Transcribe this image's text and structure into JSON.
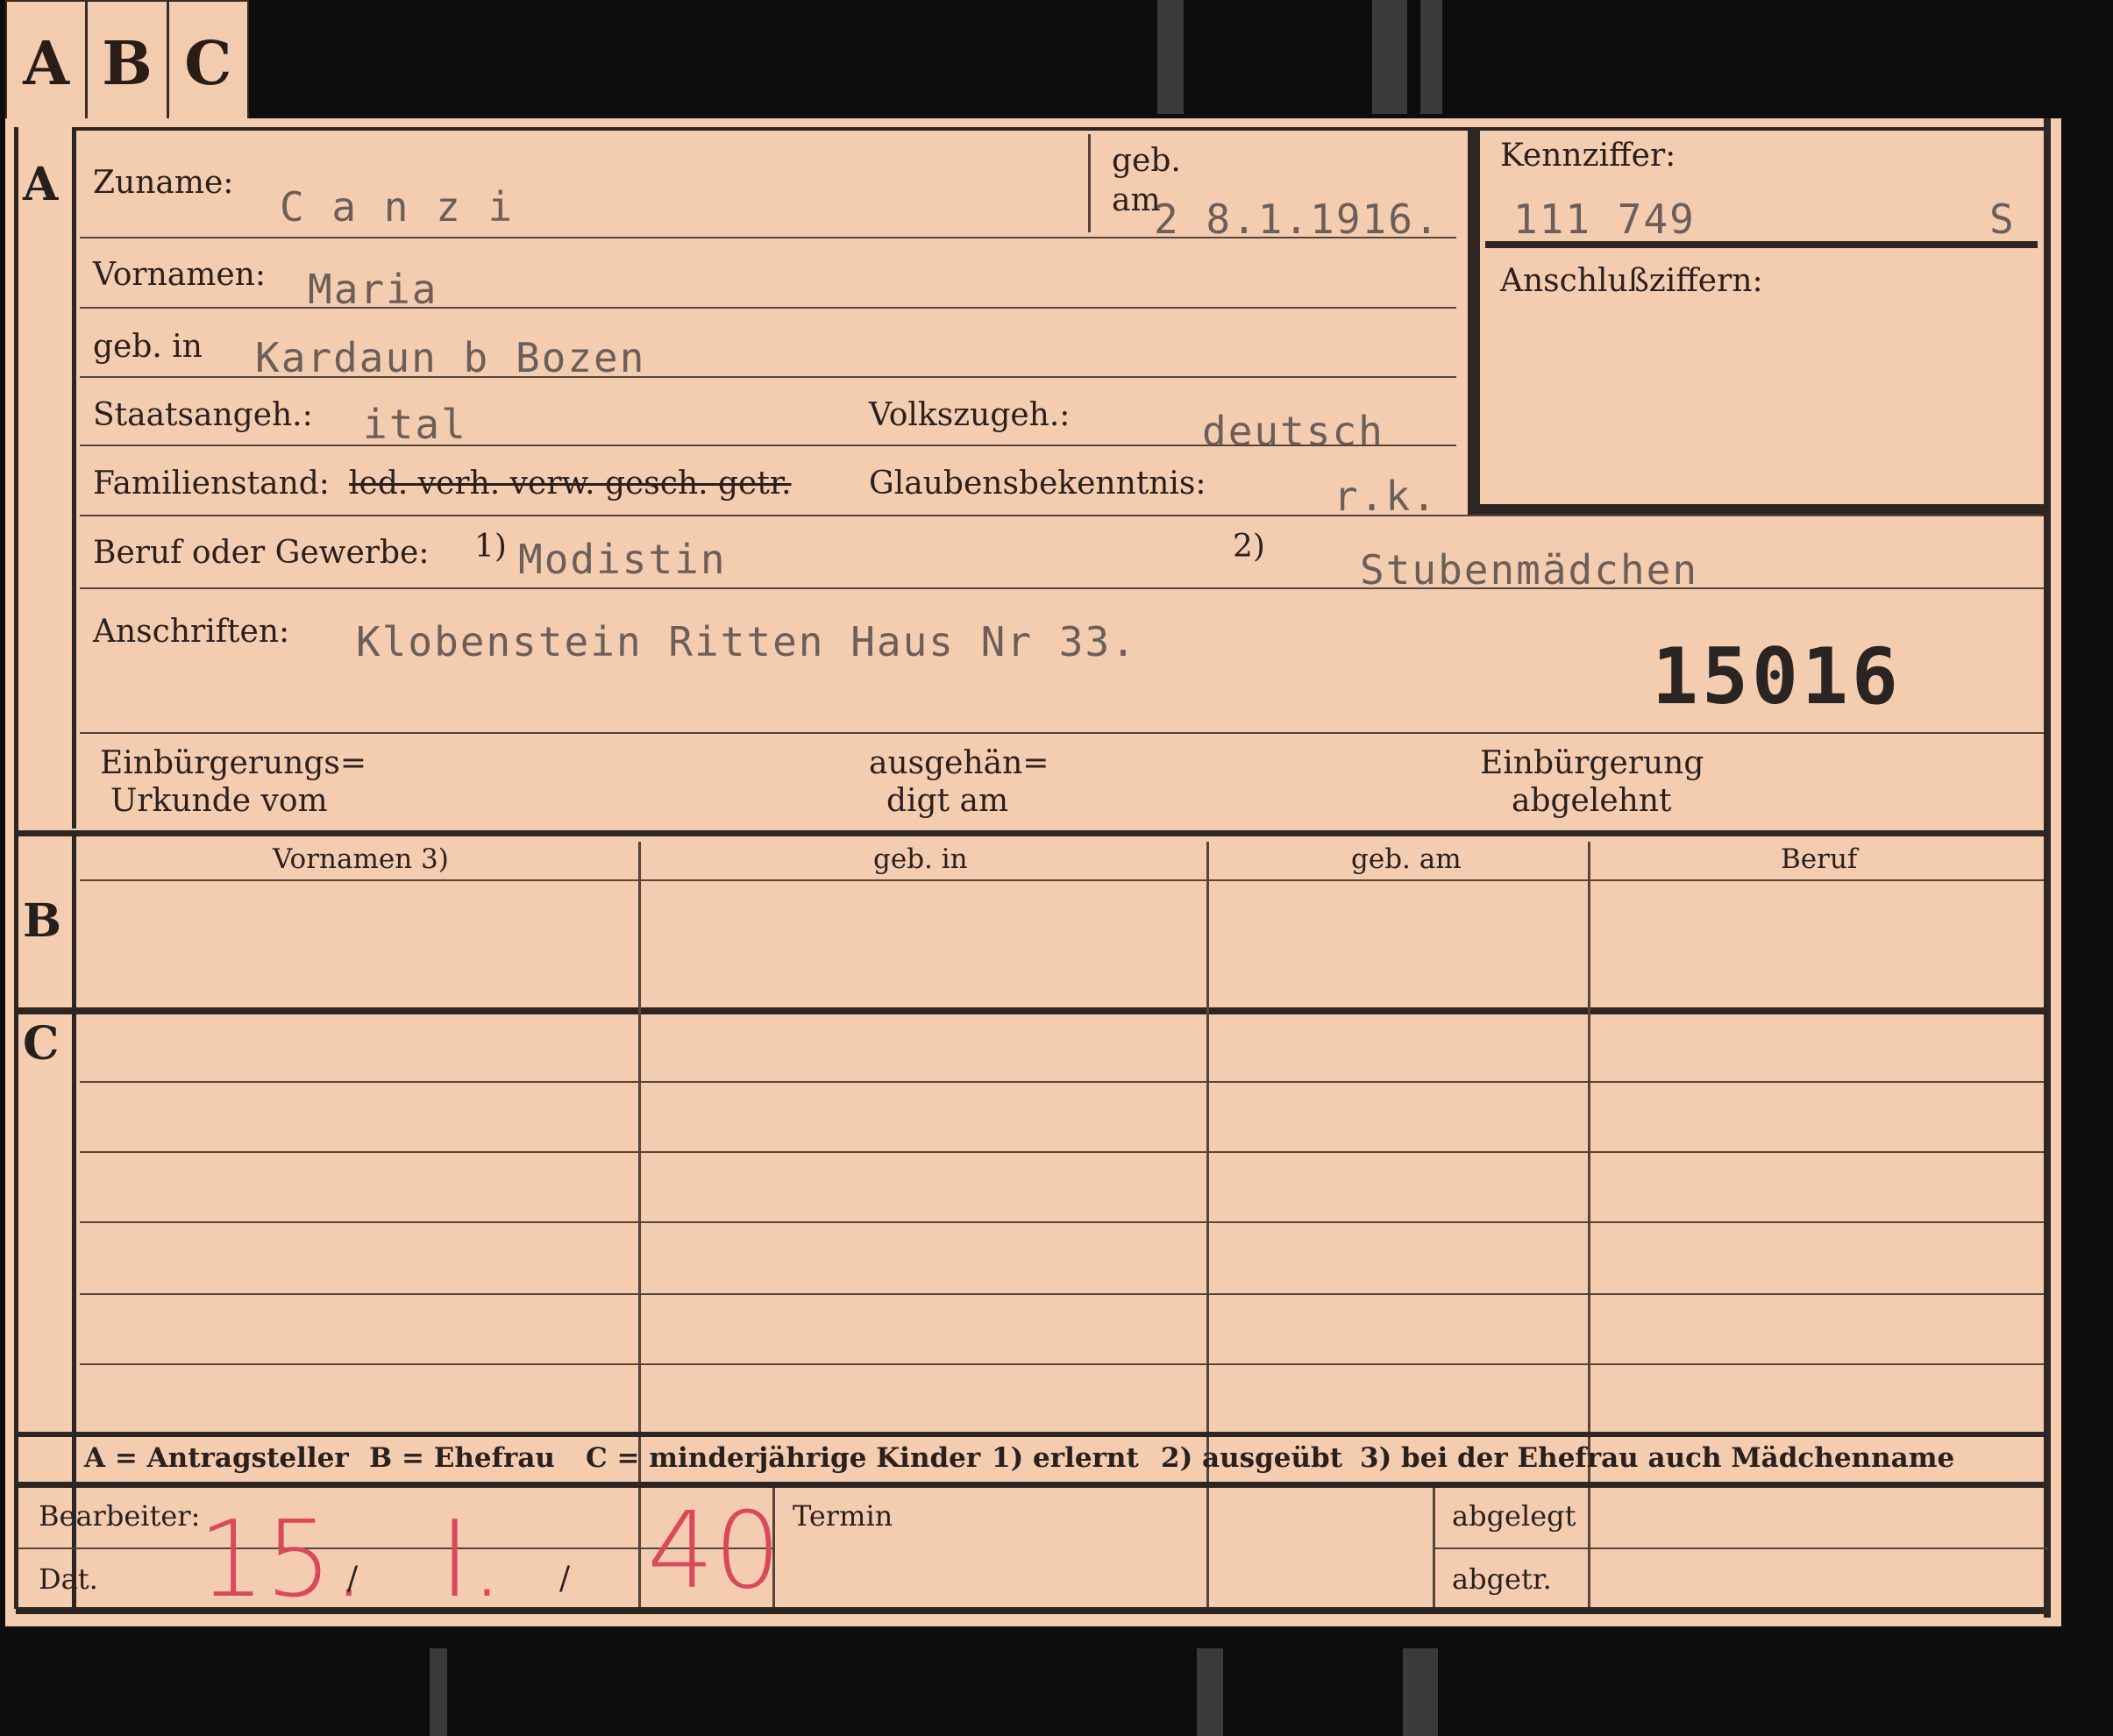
{
  "tabs": [
    "A",
    "B",
    "C"
  ],
  "sections": {
    "a": "A",
    "b": "B",
    "c": "C"
  },
  "labels": {
    "zuname": "Zuname:",
    "geb": "geb.",
    "am": "am",
    "kennziffer": "Kennziffer:",
    "anschlussziffern": "Anschlußziffern:",
    "vornamen": "Vornamen:",
    "geb_in": "geb. in",
    "staatsangeh": "Staatsangeh.:",
    "volkszugeh": "Volkszugeh.:",
    "familienstand": "Familienstand:",
    "familienstand_options": "led. verh. verw. gesch. getr.",
    "glaubensbekenntnis": "Glaubensbekenntnis:",
    "beruf": "Beruf oder Gewerbe:",
    "beruf_note1": "1)",
    "beruf_note2": "2)",
    "anschriften": "Anschriften:",
    "einbuergerungs_1": "Einbürgerungs=",
    "einbuergerungs_2": "Urkunde vom",
    "ausgehaen_1": "ausgehän=",
    "ausgehaen_2": "digt am",
    "einbuergerung_1": "Einbürgerung",
    "einbuergerung_2": "abgelehnt"
  },
  "values": {
    "zuname": "C a n z i",
    "geb_am": "2 8.1.1916.",
    "kennziffer": "111 749",
    "kennziffer_suffix": "S",
    "vornamen": "Maria",
    "geb_in": "Kardaun b Bozen",
    "staatsangeh": "ital",
    "volkszugeh": "deutsch",
    "glaubensbekenntnis": "r.k.",
    "beruf_1": "Modistin",
    "beruf_2": "Stubenmädchen",
    "anschriften": "Klobenstein Ritten Haus Nr 33.",
    "stamp_number": "15016"
  },
  "table": {
    "headers": [
      "Vornamen 3)",
      "geb. in",
      "geb. am",
      "Beruf"
    ]
  },
  "legend": {
    "a": "A = Antragsteller",
    "b": "B = Ehefrau",
    "c": "C = minderjährige Kinder",
    "n1": "1) erlernt",
    "n2": "2) ausgeübt",
    "n3": "3) bei der Ehefrau auch Mädchenname"
  },
  "footer": {
    "bearbeiter": "Bearbeiter:",
    "dat": "Dat.",
    "termin": "Termin",
    "abgelegt": "abgelegt",
    "abgetr": "abgetr.",
    "date_day": "15.",
    "date_month": "I.",
    "date_year": "40",
    "date_sep": "/"
  },
  "colors": {
    "card": "#f4cdb1",
    "ink": "#2b201d",
    "typewriter": "#6c5e58",
    "red_pencil": "#d9495a",
    "background": "#0d0d0d"
  }
}
